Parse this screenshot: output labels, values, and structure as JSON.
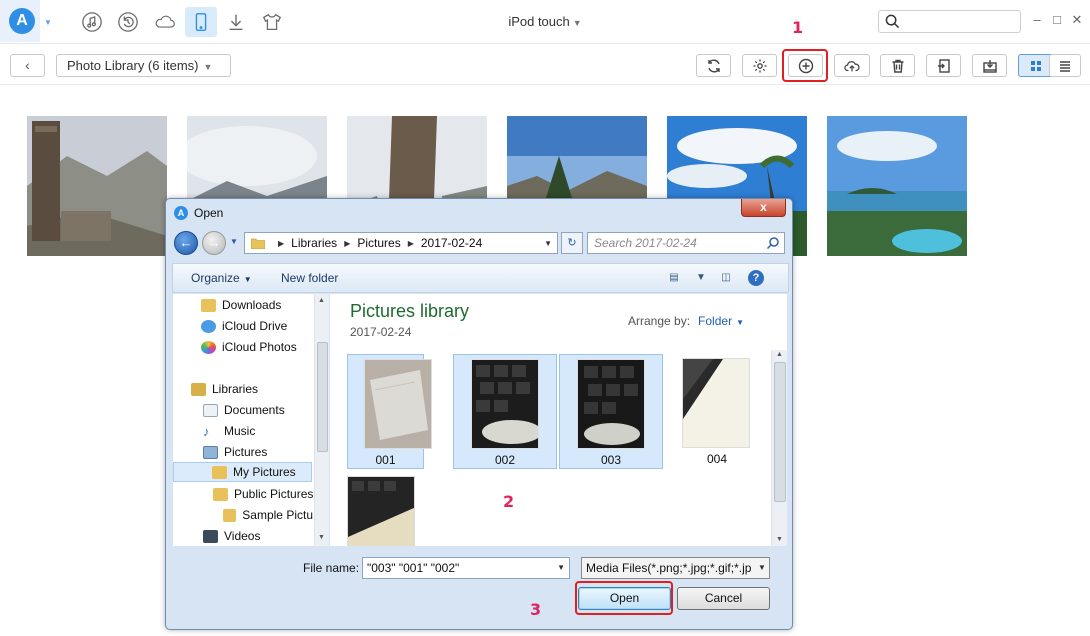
{
  "titlebar": {
    "device": "iPod touch",
    "icons": [
      "music-icon",
      "restore-icon",
      "cloud-icon",
      "device-icon",
      "download-icon",
      "tshirt-icon"
    ],
    "search_placeholder": ""
  },
  "toolbar": {
    "library_label": "Photo Library (6 items)",
    "tools": [
      "refresh-icon",
      "settings-icon",
      "add-icon",
      "cloud-upload-icon",
      "trash-icon",
      "export-icon",
      "import-icon",
      "grid-view-icon",
      "list-view-icon"
    ]
  },
  "annotations": {
    "step1": "1",
    "step2": "2",
    "step3": "3"
  },
  "dialog": {
    "title": "Open",
    "close": "x",
    "address": {
      "root": "Libraries",
      "folder": "Pictures",
      "sub": "2017-02-24"
    },
    "search_placeholder": "Search 2017-02-24",
    "organize": "Organize",
    "new_folder": "New folder",
    "help": "?",
    "nav_items": [
      {
        "label": "Downloads",
        "icon": "folder-icon"
      },
      {
        "label": "iCloud Drive",
        "icon": "icloud-drive-icon"
      },
      {
        "label": "iCloud Photos",
        "icon": "icloud-photos-icon"
      },
      {
        "label": "Libraries",
        "icon": "libraries-icon"
      },
      {
        "label": "Documents",
        "icon": "documents-icon"
      },
      {
        "label": "Music",
        "icon": "music-note-icon"
      },
      {
        "label": "Pictures",
        "icon": "pictures-icon"
      },
      {
        "label": "My Pictures",
        "icon": "folder-icon"
      },
      {
        "label": "Public Pictures",
        "icon": "folder-icon"
      },
      {
        "label": "Sample Pictu",
        "icon": "folder-icon"
      },
      {
        "label": "Videos",
        "icon": "videos-icon"
      }
    ],
    "library_title": "Pictures library",
    "library_date": "2017-02-24",
    "arrange_by": "Arrange by:",
    "arrange_value": "Folder",
    "files": [
      {
        "name": "001",
        "selected": true
      },
      {
        "name": "002",
        "selected": true
      },
      {
        "name": "003",
        "selected": true
      },
      {
        "name": "004",
        "selected": false
      },
      {
        "name": "",
        "selected": false
      }
    ],
    "file_name_label": "File name:",
    "file_name_value": "\"003\" \"001\" \"002\"",
    "filter": "Media Files(*.png;*.jpg;*.gif;*.jp",
    "open": "Open",
    "cancel": "Cancel"
  }
}
